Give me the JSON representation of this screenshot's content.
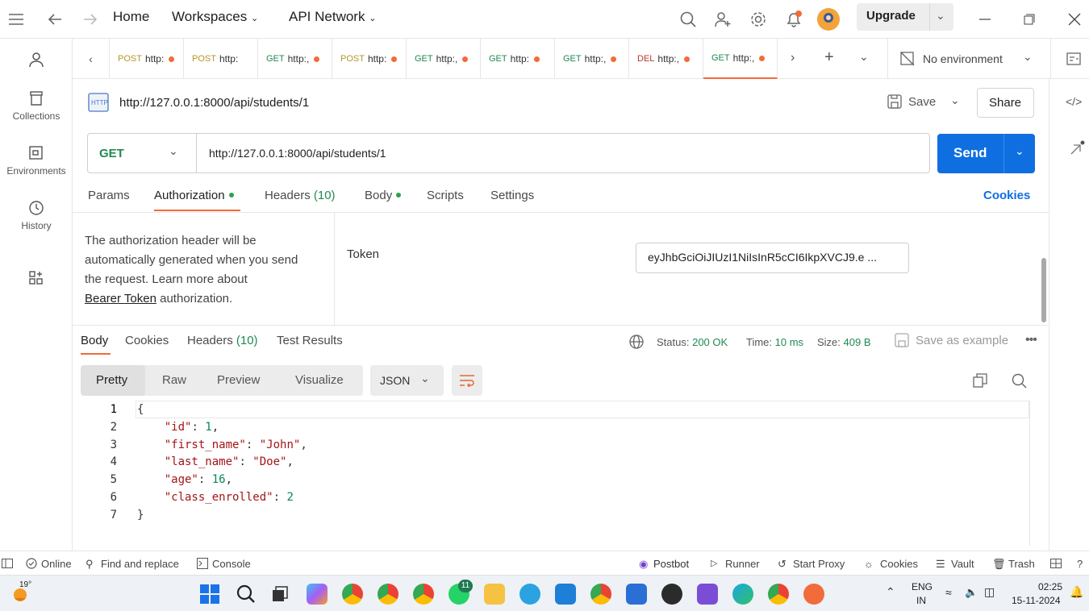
{
  "titlebar": {
    "home": "Home",
    "workspaces": "Workspaces",
    "api_network": "API Network",
    "upgrade": "Upgrade"
  },
  "sidebar": {
    "items": [
      {
        "label": ""
      },
      {
        "label": "Collections"
      },
      {
        "label": "Environments"
      },
      {
        "label": "History"
      }
    ]
  },
  "tabs": [
    {
      "method": "POST",
      "url": "http:",
      "dot": true
    },
    {
      "method": "POST",
      "url": "http:",
      "dot": false
    },
    {
      "method": "GET",
      "url": "http:,",
      "dot": true
    },
    {
      "method": "POST",
      "url": "http:",
      "dot": true
    },
    {
      "method": "GET",
      "url": "http:,",
      "dot": true
    },
    {
      "method": "GET",
      "url": "http:",
      "dot": true
    },
    {
      "method": "GET",
      "url": "http:,",
      "dot": true
    },
    {
      "method": "DEL",
      "url": "http:,",
      "dot": true
    },
    {
      "method": "GET",
      "url": "http:,",
      "dot": true,
      "active": true
    }
  ],
  "environment": "No environment",
  "request": {
    "title": "http://127.0.0.1:8000/api/students/1",
    "save": "Save",
    "share": "Share",
    "method": "GET",
    "url": "http://127.0.0.1:8000/api/students/1",
    "send": "Send",
    "tabs": {
      "params": "Params",
      "authorization": "Authorization",
      "headers": "Headers",
      "headers_count": "(10)",
      "body": "Body",
      "scripts": "Scripts",
      "settings": "Settings",
      "cookies": "Cookies"
    }
  },
  "auth": {
    "description_1": "The authorization header will be",
    "description_2": "automatically generated when you send",
    "description_3": "the request. Learn more about",
    "link": "Bearer Token",
    "description_4": " authorization.",
    "token_label": "Token",
    "token_value": "eyJhbGciOiJIUzI1NiIsInR5cCI6IkpXVCJ9.e ..."
  },
  "response": {
    "tabs": {
      "body": "Body",
      "cookies": "Cookies",
      "headers": "Headers",
      "headers_count": "(10)",
      "test_results": "Test Results"
    },
    "status_label": "Status:",
    "status_value": "200 OK",
    "time_label": "Time:",
    "time_value": "10 ms",
    "size_label": "Size:",
    "size_value": "409 B",
    "save_example": "Save as example",
    "views": {
      "pretty": "Pretty",
      "raw": "Raw",
      "preview": "Preview",
      "visualize": "Visualize"
    },
    "format": "JSON",
    "lines": [
      {
        "no": "1",
        "text": "{"
      },
      {
        "no": "2",
        "key": "\"id\"",
        "value": "1",
        "type": "n",
        "comma": ","
      },
      {
        "no": "3",
        "key": "\"first_name\"",
        "value": "\"John\"",
        "type": "s",
        "comma": ","
      },
      {
        "no": "4",
        "key": "\"last_name\"",
        "value": "\"Doe\"",
        "type": "s",
        "comma": ","
      },
      {
        "no": "5",
        "key": "\"age\"",
        "value": "16",
        "type": "n",
        "comma": ","
      },
      {
        "no": "6",
        "key": "\"class_enrolled\"",
        "value": "2",
        "type": "n",
        "comma": ""
      },
      {
        "no": "7",
        "text": "}"
      }
    ]
  },
  "statusbar": {
    "online": "Online",
    "find_replace": "Find and replace",
    "console": "Console",
    "postbot": "Postbot",
    "runner": "Runner",
    "start_proxy": "Start Proxy",
    "cookies": "Cookies",
    "vault": "Vault",
    "trash": "Trash"
  },
  "taskbar": {
    "temperature": "19°",
    "lang_1": "ENG",
    "lang_2": "IN",
    "time": "02:25",
    "date": "15-11-2024",
    "badge_whatsapp": "11"
  }
}
